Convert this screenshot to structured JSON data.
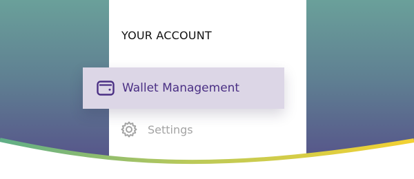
{
  "panel": {
    "title": "YOUR ACCOUNT"
  },
  "menu": {
    "items": [
      {
        "label": "Wallet Management",
        "icon": "wallet-icon",
        "active": true
      },
      {
        "label": "Settings",
        "icon": "gear-icon",
        "active": false
      }
    ]
  },
  "colors": {
    "active_text": "#4a2f84",
    "active_bg": "#dcd6e6",
    "inactive_text": "#a3a3a3",
    "backdrop_top": "#6aa09a",
    "backdrop_bottom": "#544a88",
    "curve_green": "#5fae87",
    "curve_yellow": "#f3d132"
  }
}
